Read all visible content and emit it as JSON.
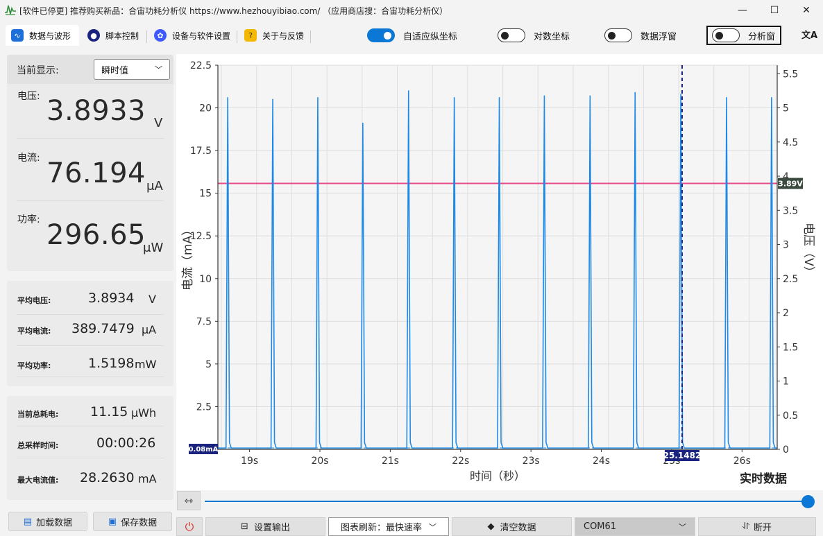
{
  "window": {
    "title": "[软件已停更] 推荐购买新品：合宙功耗分析仪 https://www.hezhouyibiao.com/ （应用商店搜：合宙功耗分析仪）",
    "minimize": "—",
    "maximize": "☐",
    "close": "✕"
  },
  "tabs": [
    {
      "label": "数据与波形",
      "icon": "wave-icon",
      "active": true
    },
    {
      "label": "脚本控制",
      "icon": "script-icon"
    },
    {
      "label": "设备与软件设置",
      "icon": "settings-icon"
    },
    {
      "label": "关于与反馈",
      "icon": "help-icon"
    }
  ],
  "toggles": [
    {
      "label": "自适应纵坐标",
      "on": true
    },
    {
      "label": "对数坐标",
      "on": false
    },
    {
      "label": "数据浮窗",
      "on": false
    },
    {
      "label": "分析窗",
      "on": false
    }
  ],
  "translate_glyph": "文A",
  "current_display": {
    "label": "当前显示:",
    "selected": "瞬时值"
  },
  "readings": {
    "voltage": {
      "label": "电压:",
      "value": "3.8933",
      "unit": "V"
    },
    "current": {
      "label": "电流:",
      "value": "76.194",
      "unit": "μA"
    },
    "power": {
      "label": "功率:",
      "value": "296.65",
      "unit": "μW"
    }
  },
  "averages": {
    "voltage": {
      "label": "平均电压:",
      "value": "3.8934",
      "unit": "V"
    },
    "current": {
      "label": "平均电流:",
      "value": "389.7479",
      "unit": "μA"
    },
    "power": {
      "label": "平均功率:",
      "value": "1.5198",
      "unit": "mW"
    }
  },
  "totals": {
    "energy": {
      "label": "当前总耗电:",
      "value": "11.15",
      "unit": "μWh"
    },
    "duration": {
      "label": "总采样时间:",
      "value": "00:00:26"
    },
    "max_current": {
      "label": "最大电流值:",
      "value": "28.2630",
      "unit": "mA"
    }
  },
  "buttons": {
    "load": "加载数据",
    "save": "保存数据",
    "output_settings": "设置输出",
    "refresh": "图表刷新：最快速率",
    "clear": "清空数据",
    "port": "COM61",
    "disconnect": "断开"
  },
  "chart_data": {
    "type": "line",
    "ylabel": "电流（mA）",
    "y2label": "电压（V）",
    "xlabel": "时间（秒）",
    "status": "实时数据",
    "xlim": [
      18.55,
      26.5
    ],
    "ylim": [
      0,
      22.5
    ],
    "y2lim": [
      0,
      5.625
    ],
    "x_ticks": [
      19,
      20,
      21,
      22,
      23,
      24,
      25,
      26
    ],
    "x_tick_labels": [
      "19s",
      "20s",
      "21s",
      "22s",
      "23s",
      "24s",
      "25s",
      "26s"
    ],
    "y_ticks": [
      0,
      2.5,
      5,
      7.5,
      10,
      12.5,
      15,
      17.5,
      20,
      22.5
    ],
    "y_tick_labels": [
      "0",
      "2.5",
      "5",
      "7.5",
      "10",
      "12.5",
      "15",
      "17.5",
      "20",
      "22.5"
    ],
    "y2_ticks": [
      0,
      0.5,
      1,
      1.5,
      2,
      2.5,
      3,
      3.5,
      4,
      4.5,
      5,
      5.5
    ],
    "y2_tick_labels": [
      "0",
      "0.5",
      "1",
      "1.5",
      "2",
      "2.5",
      "3",
      "3.5",
      "4",
      "4.5",
      "5",
      "5.5"
    ],
    "grid": true,
    "baseline_current_mA": 0.076,
    "spikes": [
      {
        "x": 18.69,
        "y": 20.6
      },
      {
        "x": 19.33,
        "y": 20.5
      },
      {
        "x": 19.97,
        "y": 20.6
      },
      {
        "x": 20.61,
        "y": 19.1
      },
      {
        "x": 21.26,
        "y": 21.0
      },
      {
        "x": 21.91,
        "y": 20.6
      },
      {
        "x": 22.55,
        "y": 20.6
      },
      {
        "x": 23.19,
        "y": 20.7
      },
      {
        "x": 23.84,
        "y": 20.7
      },
      {
        "x": 24.48,
        "y": 20.9
      },
      {
        "x": 25.13,
        "y": 20.8
      },
      {
        "x": 25.78,
        "y": 20.6
      },
      {
        "x": 26.42,
        "y": 20.6
      }
    ],
    "voltage_V": 3.8933,
    "voltage_tag": "3.89V",
    "current_tag": "0.08mA",
    "cursor_x": 25.1482,
    "cursor_label": "25.1482",
    "colors": {
      "current": "#1e8ae6",
      "voltage": "#e64a8a",
      "cursor": "#1a237e",
      "voltage_tag_bg": "#3b4a3e",
      "tag_bg": "#1a237e"
    }
  }
}
